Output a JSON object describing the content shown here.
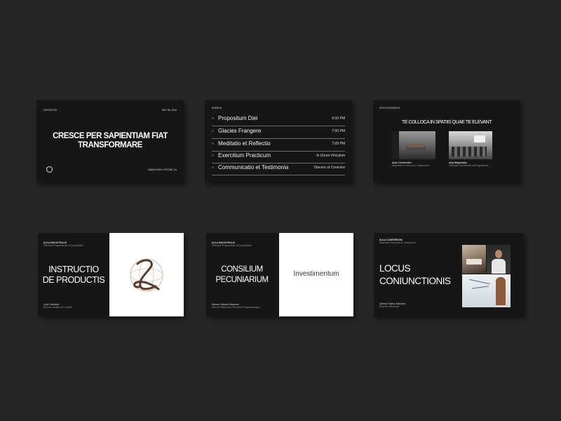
{
  "slide1": {
    "tag": "SARISCOTA",
    "date": "MAY 08, 2026",
    "title_line1": "CRESCE PER SAPIENTIAM FIAT",
    "title_line2": "TRANSFORMARE",
    "footer": "WWW.SUNSL.SITE.BE.CA"
  },
  "slide2": {
    "header": "AGENDA",
    "items": [
      {
        "label": "Propositum Diei",
        "value": "6:00 PM"
      },
      {
        "label": "Glacies Frangere",
        "value": "7:00 PM"
      },
      {
        "label": "Meditatio et Reflectio",
        "value": "7:05 PM"
      },
      {
        "label": "Exercitium Practicum",
        "value": "In Unum Vinculum"
      },
      {
        "label": "Communicatio et Testimonia",
        "value": "Discere ut Crescere"
      }
    ]
  },
  "slide3": {
    "header": "SPATIA SEPARATA",
    "title": "TE COLLOCA IN SPATIIS QUAE TE ELEVANT",
    "cards": [
      {
        "name": "Aula Conferentiis",
        "desc": "Negotium et Occursus Collaborativi"
      },
      {
        "name": "Aula Magistralis",
        "desc": "Officinae Creativitatis et Programmae"
      }
    ]
  },
  "slide4": {
    "tag": "AULA MAGISTRALIS",
    "sub": "Officinae Programmae et Creativitatis",
    "title_line1": "INSTRUCTIO",
    "title_line2": "DE PRODUCTIS",
    "person": "Livia Celestina",
    "role": "Director Aedificii et Consilii"
  },
  "slide5": {
    "tag": "AULA MAGISTRALIS",
    "sub": "Officinae Programmae et Creativitatis",
    "title_line1": "CONSILIUM",
    "title_line2": "PECUNIARIUM",
    "person": "Marcus Valerius Maximus",
    "role": "Director Rationum Pecuniae Programmaeque",
    "right_text": "Investimentum"
  },
  "slide6": {
    "tag": "AULA CONFERENDII",
    "sub": "Negotium Occursus et Conventum",
    "title_line1": "LOCUS",
    "title_line2": "CONIUNCTIONIS",
    "person": "Quintus Fabius Maximus",
    "role": "Director Officiorum"
  },
  "icons": {
    "logo": "globe-monogram-logo"
  }
}
